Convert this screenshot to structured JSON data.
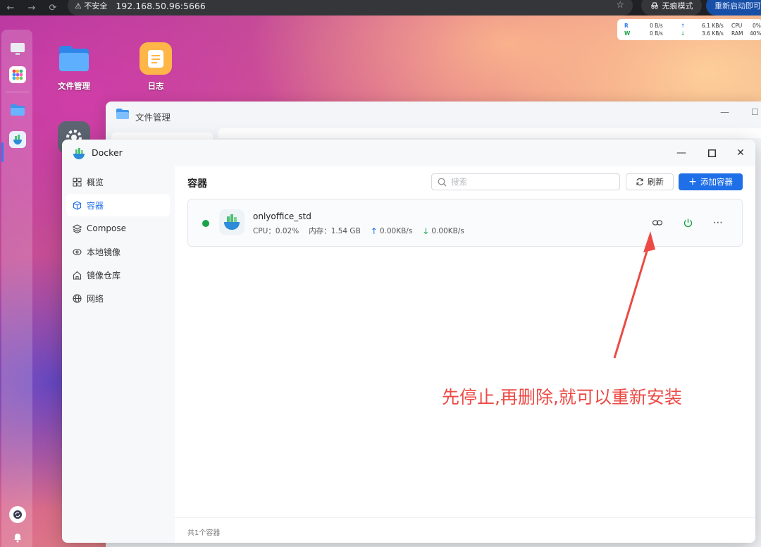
{
  "browser": {
    "back_icon": "←",
    "forward_icon": "→",
    "reload_icon": "⟳",
    "security_warning": "⚠ 不安全",
    "url": "192.168.50.96:5666",
    "star_icon": "☆",
    "incognito_label": "无痕模式",
    "restart_label": "重新启动即可"
  },
  "monitor": {
    "read_label": "R",
    "write_label": "W",
    "read_rate": "0  B/s",
    "write_rate": "0  B/s",
    "upload": "6.1 KB/s",
    "download": "3.6 KB/s",
    "cpu_label": "CPU",
    "ram_label": "RAM",
    "cpu_value": "0%",
    "ram_value": "40%"
  },
  "desktop": {
    "icons": [
      {
        "label": "文件管理"
      },
      {
        "label": "日志"
      }
    ]
  },
  "file_manager": {
    "title": "文件管理"
  },
  "docker": {
    "title": "Docker",
    "sidebar": [
      {
        "label": "概览",
        "icon": "grid-icon"
      },
      {
        "label": "容器",
        "icon": "cube-icon"
      },
      {
        "label": "Compose",
        "icon": "layers-icon"
      },
      {
        "label": "本地镜像",
        "icon": "disc-icon"
      },
      {
        "label": "镜像仓库",
        "icon": "home-icon"
      },
      {
        "label": "网络",
        "icon": "globe-icon"
      }
    ],
    "active_item": "容器",
    "main": {
      "title": "容器",
      "search_placeholder": "搜索",
      "refresh_label": "刷新",
      "add_label": "添加容器",
      "footer": "共1个容器"
    },
    "containers": [
      {
        "name": "onlyoffice_std",
        "status": "running",
        "cpu": "CPU：0.02%",
        "memory": "内存：1.54 GB",
        "upload": "0.00KB/s",
        "download": "0.00KB/s"
      }
    ]
  },
  "annotation": {
    "text": "先停止,再删除,就可以重新安装"
  },
  "colors": {
    "accent": "#1e6fe8",
    "running": "#1aa34a",
    "annotation": "#ec4a45"
  }
}
